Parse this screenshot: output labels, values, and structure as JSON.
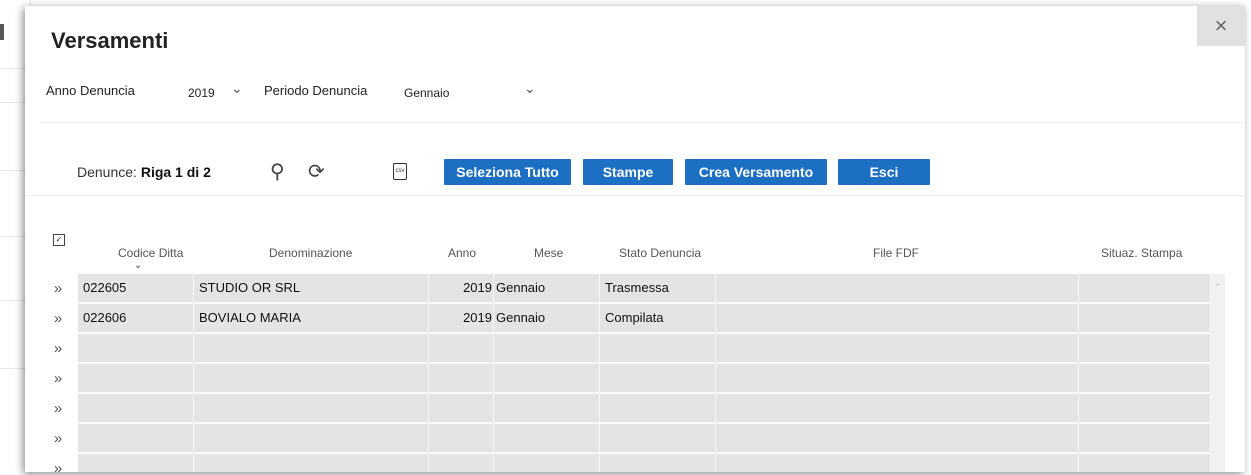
{
  "dialog": {
    "title": "Versamenti",
    "close_glyph": "×"
  },
  "filters": {
    "anno_label": "Anno Denuncia",
    "anno_value": "2019",
    "periodo_label": "Periodo Denuncia",
    "periodo_value": "Gennaio"
  },
  "toolbar": {
    "counter_prefix": "Denunce:",
    "counter_value": "Riga 1 di 2",
    "buttons": {
      "select_all": "Seleziona Tutto",
      "print": "Stampe",
      "create": "Crea Versamento",
      "exit": "Esci"
    },
    "icons": [
      "search-icon",
      "refresh-icon",
      "csv-export-icon"
    ]
  },
  "table": {
    "columns": [
      "Codice Ditta",
      "Denominazione",
      "Anno",
      "Mese",
      "Stato Denuncia",
      "File FDF",
      "Situaz. Stampa"
    ],
    "rows": [
      {
        "codice": "022605",
        "denominazione": "STUDIO OR SRL",
        "anno": "2019",
        "mese": "Gennaio",
        "stato": "Trasmessa",
        "file": "",
        "situaz": ""
      },
      {
        "codice": "022606",
        "denominazione": "BOVIALO MARIA",
        "anno": "2019",
        "mese": "Gennaio",
        "stato": "Compilata",
        "file": "",
        "situaz": ""
      },
      {
        "codice": "",
        "denominazione": "",
        "anno": "",
        "mese": "",
        "stato": "",
        "file": "",
        "situaz": ""
      },
      {
        "codice": "",
        "denominazione": "",
        "anno": "",
        "mese": "",
        "stato": "",
        "file": "",
        "situaz": ""
      },
      {
        "codice": "",
        "denominazione": "",
        "anno": "",
        "mese": "",
        "stato": "",
        "file": "",
        "situaz": ""
      },
      {
        "codice": "",
        "denominazione": "",
        "anno": "",
        "mese": "",
        "stato": "",
        "file": "",
        "situaz": ""
      },
      {
        "codice": "",
        "denominazione": "",
        "anno": "",
        "mese": "",
        "stato": "",
        "file": "",
        "situaz": ""
      }
    ]
  },
  "colors": {
    "button": "#1d6fc4",
    "row": "#e4e4e4",
    "close_bg": "#e1e1e1"
  }
}
